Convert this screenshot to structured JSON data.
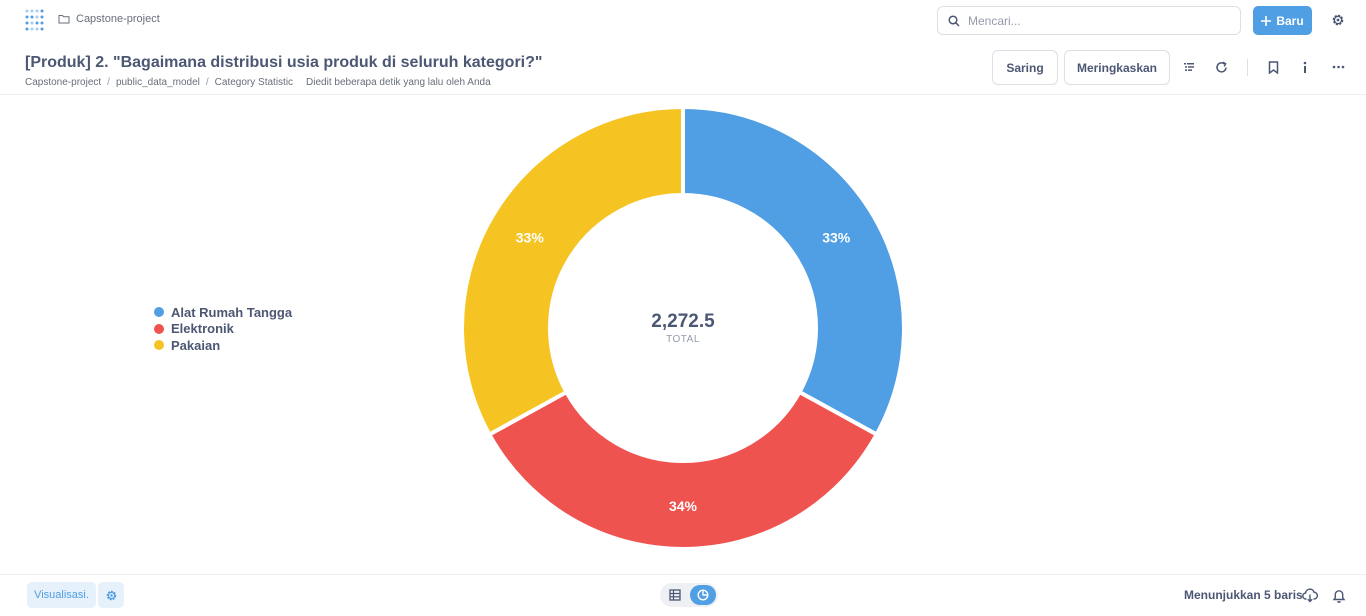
{
  "topnav": {
    "collection": "Capstone-project",
    "search_placeholder": "Mencari...",
    "new_button": "Baru"
  },
  "header": {
    "title": "[Produk] 2. \"Bagaimana distribusi usia produk di seluruh kategori?\"",
    "breadcrumb": [
      "Capstone-project",
      "public_data_model",
      "Category Statistic"
    ],
    "edited": "Diedit beberapa detik yang lalu oleh Anda",
    "filter_button": "Saring",
    "summarize_button": "Meringkaskan"
  },
  "chart_data": {
    "type": "pie",
    "style": "donut",
    "total": "2,272.5",
    "total_label": "TOTAL",
    "legend_position": "left",
    "slices": [
      {
        "name": "Alat Rumah Tangga",
        "percent": 33,
        "label": "33%",
        "color": "#509EE3"
      },
      {
        "name": "Elektronik",
        "percent": 34,
        "label": "34%",
        "color": "#EF5350"
      },
      {
        "name": "Pakaian",
        "percent": 33,
        "label": "33%",
        "color": "#F5C423"
      }
    ]
  },
  "footer": {
    "visualize_button": "Visualisasi.",
    "rows_text": "Menunjukkan 5 baris"
  },
  "colors": {
    "accent": "#509EE3",
    "text": "#4C5773"
  }
}
